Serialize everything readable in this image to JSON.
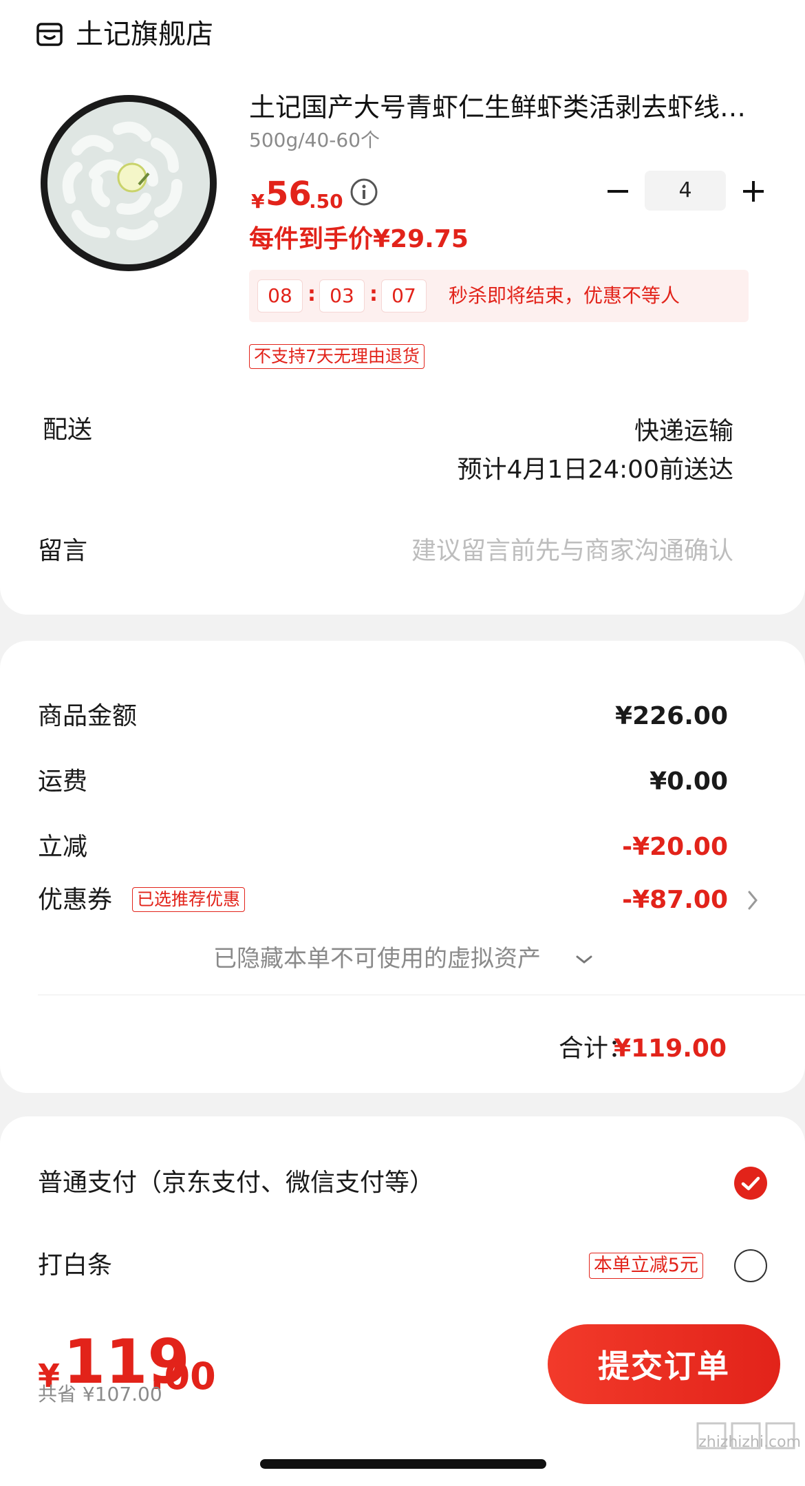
{
  "shop": {
    "name": "土记旗舰店",
    "icon": "shop-icon"
  },
  "product": {
    "title": "土记国产大号青虾仁生鲜虾类活剥去虾线…",
    "spec": "500g/40-60个",
    "price_symbol": "¥",
    "price_integer": "56",
    "price_decimal": ".50",
    "quantity": "4",
    "unit_price": "每件到手价¥29.75",
    "countdown": {
      "hours": "08",
      "minutes": "03",
      "seconds": "07",
      "separator": ":",
      "message": "秒杀即将结束，优惠不等人"
    },
    "return_policy_tag": "不支持7天无理由退货"
  },
  "shipping": {
    "label": "配送",
    "method": "快递运输",
    "eta": "预计4月1日24:00前送达"
  },
  "message": {
    "label": "留言",
    "placeholder": "建议留言前先与商家沟通确认"
  },
  "price_details": {
    "goods_label": "商品金额",
    "goods_value": "¥226.00",
    "freight_label": "运费",
    "freight_value": "¥0.00",
    "discount_label": "立减",
    "discount_value": "-¥20.00",
    "coupon_label": "优惠券",
    "coupon_tag": "已选推荐优惠",
    "coupon_value": "-¥87.00",
    "hidden_assets": "已隐藏本单不可使用的虚拟资产",
    "total_label": "合计：",
    "total_value": "¥119.00"
  },
  "payment": {
    "option1_label": "普通支付（京东支付、微信支付等）",
    "option2_label": "打白条",
    "option2_tag": "本单立减5元",
    "selected": "option1"
  },
  "bottom": {
    "total_symbol": "¥",
    "total_integer": "119",
    "total_decimal": ".00",
    "saved": "共省 ¥107.00",
    "submit_label": "提交订单"
  },
  "watermark": "zhizhizhi.com",
  "colors": {
    "accent": "#e2231a",
    "muted": "#8a8a8a",
    "background": "#f2f2f2"
  }
}
